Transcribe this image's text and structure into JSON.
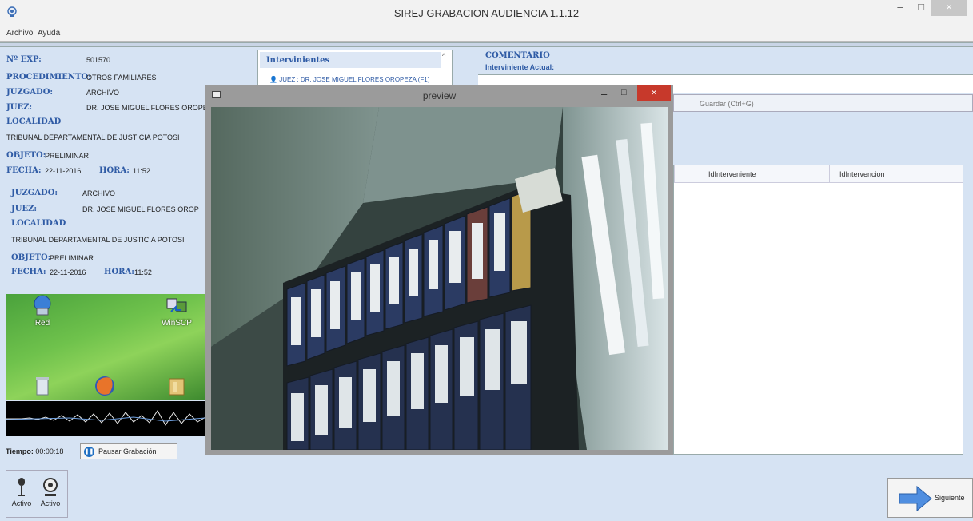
{
  "window": {
    "title": "SIREJ GRABACION AUDIENCIA 1.1.12",
    "minimize": "–",
    "maximize": "□",
    "close": "×"
  },
  "menu": [
    "Archivo",
    "Ayuda"
  ],
  "expediente": {
    "nexp_label": "Nº EXP:",
    "nexp": "501570",
    "proc_label": "PROCEDIMIENTO:",
    "proc": "OTROS FAMILIARES",
    "juzgado_label": "JUZGADO:",
    "juzgado": "ARCHIVO",
    "juez_label": "JUEZ:",
    "juez": "DR. JOSE MIGUEL FLORES OROPE",
    "localidad_label": "LOCALIDAD",
    "localidad": "TRIBUNAL DEPARTAMENTAL DE JUSTICIA POTOSI",
    "objeto_label": "OBJETO:",
    "objeto": "PRELIMINAR",
    "fecha_label": "FECHA:",
    "fecha": "22-11-2016",
    "hora_label": "HORA:",
    "hora": "11:52"
  },
  "expediente_dup": {
    "juzgado_label": "JUZGADO:",
    "juzgado": "ARCHIVO",
    "juez_label": "JUEZ:",
    "juez": "DR. JOSE MIGUEL FLORES OROP",
    "localidad_label": "LOCALIDAD",
    "localidad": "TRIBUNAL DEPARTAMENTAL DE JUSTICIA POTOSI",
    "objeto_label": "OBJETO:",
    "objeto": "PRELIMINAR",
    "fecha_label": "FECHA:",
    "fecha": "22-11-2016",
    "hora_label": "HORA:",
    "hora": "11:52"
  },
  "desktop_icons": [
    "Red",
    "WinSCP"
  ],
  "recording": {
    "tiempo_label": "Tiempo:",
    "tiempo": "00:00:18",
    "pause_label": "Pausar Grabación"
  },
  "devices": [
    "Activo",
    "Activo"
  ],
  "intervinientes": {
    "title": "Intervinientes",
    "item": "JUEZ : DR. JOSE MIGUEL FLORES OROPEZA (F1)"
  },
  "comentario": {
    "title": "COMENTARIO",
    "sub": "Interviniente Actual:",
    "save_label": "Guardar (Ctrl+G)"
  },
  "grid": {
    "columns": [
      "IdInterveniente",
      "IdIntervencion"
    ]
  },
  "next_label": "Siguiente",
  "preview": {
    "title": "preview",
    "minimize": "–",
    "maximize": "□",
    "close": "×"
  }
}
